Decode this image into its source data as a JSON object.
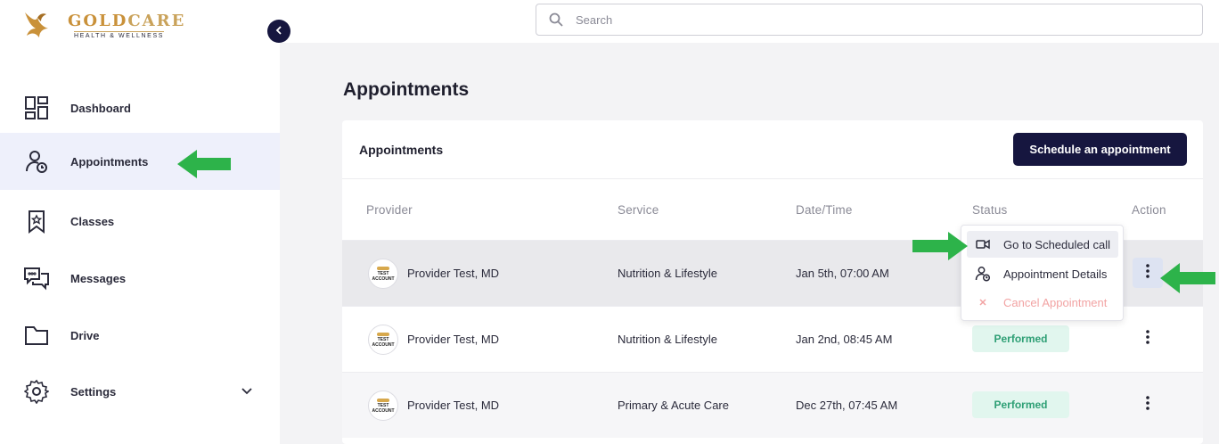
{
  "brand": {
    "name_part1": "GOLD",
    "name_part2": "CARE",
    "tagline": "HEALTH & WELLNESS"
  },
  "sidebar": {
    "items": [
      {
        "label": "Dashboard",
        "icon": "dashboard-icon",
        "active": false
      },
      {
        "label": "Appointments",
        "icon": "appointment-user-clock-icon",
        "active": true
      },
      {
        "label": "Classes",
        "icon": "bookmark-star-icon",
        "active": false
      },
      {
        "label": "Messages",
        "icon": "chat-bubbles-icon",
        "active": false
      },
      {
        "label": "Drive",
        "icon": "folder-icon",
        "active": false
      },
      {
        "label": "Settings",
        "icon": "gear-icon",
        "active": false,
        "expandable": true
      }
    ]
  },
  "search": {
    "placeholder": "Search",
    "value": ""
  },
  "page": {
    "title": "Appointments"
  },
  "card": {
    "title": "Appointments",
    "schedule_button": "Schedule an appointment",
    "columns": [
      "Provider",
      "Service",
      "Date/Time",
      "Status",
      "Action"
    ],
    "rows": [
      {
        "provider": "Provider Test, MD",
        "avatar_line1": "TEST",
        "avatar_line2": "ACCOUNT",
        "service": "Nutrition & Lifestyle",
        "datetime": "Jan 5th, 07:00 AM",
        "status": "",
        "menu_open": true
      },
      {
        "provider": "Provider Test, MD",
        "avatar_line1": "TEST",
        "avatar_line2": "ACCOUNT",
        "service": "Nutrition & Lifestyle",
        "datetime": "Jan 2nd, 08:45 AM",
        "status": "Performed"
      },
      {
        "provider": "Provider Test, MD",
        "avatar_line1": "TEST",
        "avatar_line2": "ACCOUNT",
        "service": "Primary & Acute Care",
        "datetime": "Dec 27th, 07:45 AM",
        "status": "Performed"
      }
    ]
  },
  "action_menu": {
    "items": [
      {
        "label": "Go to Scheduled call",
        "icon": "video-camera-icon",
        "highlighted": true
      },
      {
        "label": "Appointment Details",
        "icon": "user-clock-icon"
      },
      {
        "label": "Cancel Appointment",
        "icon": "close-icon",
        "danger": true
      }
    ]
  },
  "colors": {
    "navy": "#16163f",
    "gold": "#c9913a",
    "active_nav_bg": "#eef0fb",
    "badge_bg": "#e1f6ee",
    "badge_text": "#2e9f75",
    "danger_text": "#f2a3a3",
    "annotation_arrow": "#2db34a"
  }
}
